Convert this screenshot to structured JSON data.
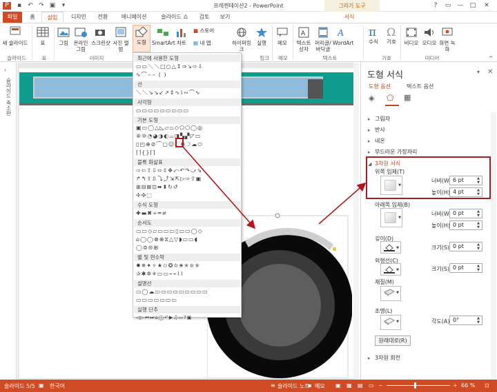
{
  "titlebar": {
    "title": "프레젠테이션2 - PowerPoint",
    "context_tab": "그리기 도구",
    "win_buttons": [
      "?",
      "▭",
      "—",
      "□",
      "✕"
    ]
  },
  "tabs": [
    "파일",
    "홈",
    "삽입",
    "디자인",
    "전환",
    "애니메이션",
    "슬라이드 쇼",
    "검토",
    "보기",
    "서식"
  ],
  "ribbon": {
    "buttons": {
      "new_slide": "새 슬라이드",
      "table": "표",
      "picture": "그림",
      "online_picture": "온라인 그림",
      "screenshot": "스크린샷",
      "photo_album": "사진 앨범",
      "shapes": "도형",
      "smartart": "SmartArt",
      "chart": "차트",
      "store": "스토어",
      "my_apps": "내 앱",
      "hyperlink": "하이퍼링크",
      "action": "실행",
      "comment": "메모",
      "textbox": "텍스트 상자",
      "header_footer": "머리글/바닥글",
      "wordart": "WordArt",
      "equation": "수식",
      "symbol": "기호",
      "video": "비디오",
      "audio": "오디오",
      "screen_recording": "화면 녹화"
    },
    "groups": {
      "slides": "슬라이드",
      "tables": "표",
      "images": "이미지",
      "links": "링크",
      "comments": "메모",
      "text": "텍스트",
      "symbols": "기호",
      "media": "미디어"
    }
  },
  "left_pane": {
    "label": "슬라이드 축소판"
  },
  "shapes_menu": {
    "sections": [
      "최근에 사용한 도형",
      "선",
      "사각형",
      "기본 도형",
      "블록 화살표",
      "수식 도형",
      "순서도",
      "별 및 현수막",
      "설명선",
      "실행 단추"
    ]
  },
  "format_panel": {
    "title": "도형 서식",
    "tabs": [
      "도형 옵션",
      "텍스트 옵션"
    ],
    "sections": [
      "그림자",
      "반사",
      "네온",
      "부드러운 가장자리",
      "3차원 서식",
      "3차원 회전"
    ],
    "top_bevel_label": "위쪽 입체(T)",
    "bottom_bevel_label": "아래쪽 입체(B)",
    "width_label": "너비(W)",
    "height_label": "높이(H)",
    "top_width": "6 pt",
    "top_height": "4 pt",
    "bottom_width": "0 pt",
    "bottom_height": "0 pt",
    "depth_label": "깊이(D)",
    "depth_size_label": "크기(S)",
    "depth_size": "0 pt",
    "contour_label": "외형선(C)",
    "contour_size_label": "크기(S)",
    "contour_size": "0 pt",
    "material_label": "재질(M)",
    "lighting_label": "조명(L)",
    "angle_label": "각도(A)",
    "angle": "0°",
    "reset_label": "원래대로(R)"
  },
  "status": {
    "slide": "슬라이드 5/5",
    "language": "한국어",
    "notes": "슬라이드 노트",
    "comments": "메모",
    "zoom": "66 %"
  },
  "colors": {
    "accent": "#d04b23",
    "highlight": "#c0101b",
    "banner": "#0e9d8e"
  }
}
